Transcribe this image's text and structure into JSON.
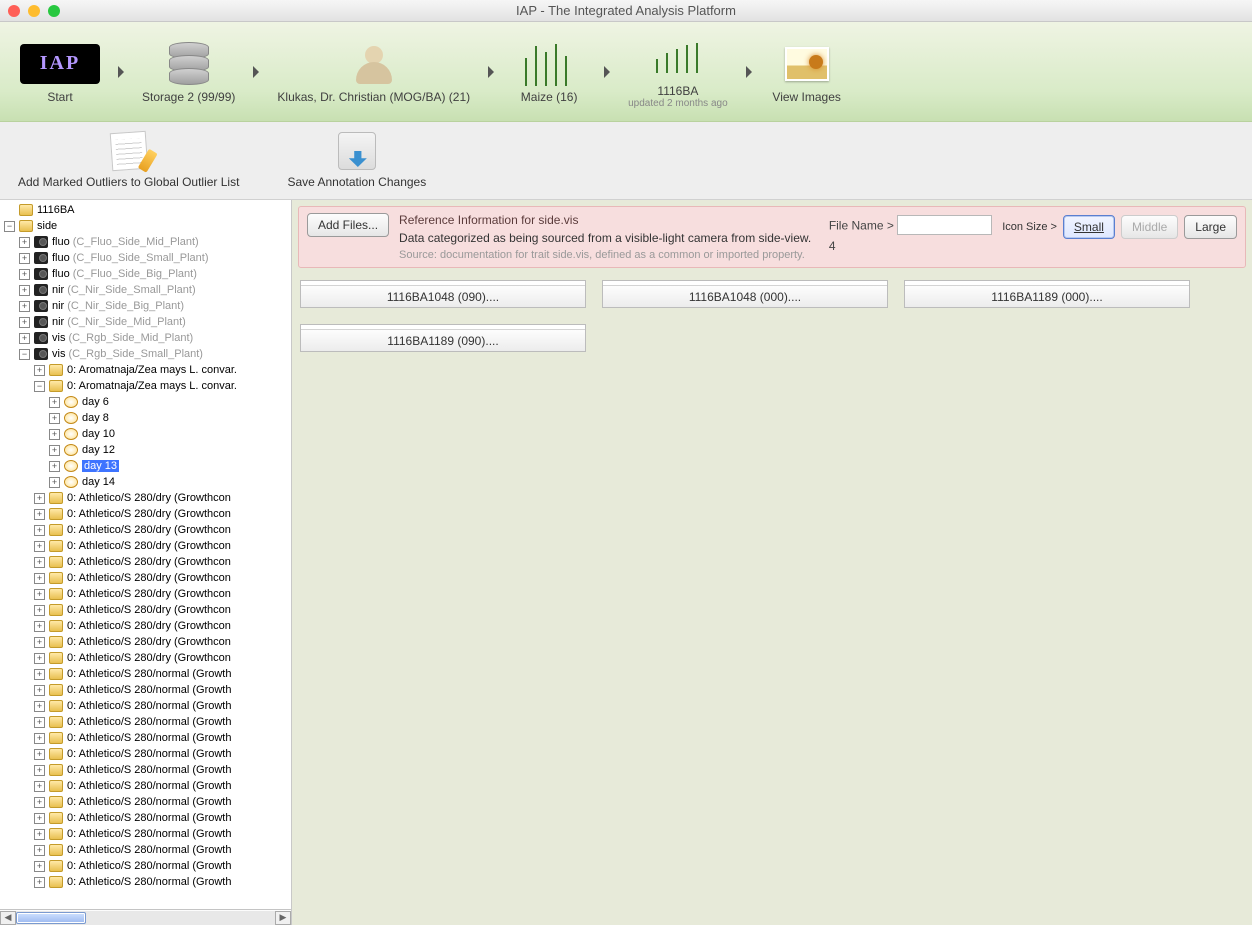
{
  "window": {
    "title": "IAP - The Integrated Analysis Platform"
  },
  "breadcrumb": [
    {
      "label": "Start",
      "icon": "iap"
    },
    {
      "label": "Storage 2 (99/99)",
      "icon": "db"
    },
    {
      "label": "Klukas, Dr. Christian (MOG/BA) (21)",
      "icon": "person"
    },
    {
      "label": "Maize (16)",
      "icon": "plants-big"
    },
    {
      "label": "1116BA",
      "sub": "updated 2 months ago",
      "icon": "plants-small"
    },
    {
      "label": "View Images",
      "icon": "photo"
    }
  ],
  "toolbar": {
    "outliers": "Add Marked Outliers to Global Outlier List",
    "save": "Save Annotation Changes"
  },
  "tree": {
    "root": "1116BA",
    "side": "side",
    "cams": [
      {
        "name": "fluo",
        "hint": "(C_Fluo_Side_Mid_Plant)"
      },
      {
        "name": "fluo",
        "hint": "(C_Fluo_Side_Small_Plant)"
      },
      {
        "name": "fluo",
        "hint": "(C_Fluo_Side_Big_Plant)"
      },
      {
        "name": "nir",
        "hint": "(C_Nir_Side_Small_Plant)"
      },
      {
        "name": "nir",
        "hint": "(C_Nir_Side_Big_Plant)"
      },
      {
        "name": "nir",
        "hint": "(C_Nir_Side_Mid_Plant)"
      },
      {
        "name": "vis",
        "hint": "(C_Rgb_Side_Mid_Plant)"
      },
      {
        "name": "vis",
        "hint": "(C_Rgb_Side_Small_Plant)",
        "expanded": true
      }
    ],
    "aroma1": "0: Aromatnaja/Zea mays L. convar.",
    "aroma2": "0: Aromatnaja/Zea mays L. convar.",
    "days": [
      "day 6",
      "day 8",
      "day 10",
      "day 12",
      "day 13",
      "day 14"
    ],
    "daysSelectedIndex": 4,
    "athletico": [
      "0: Athletico/S 280/dry (Growthcon",
      "0: Athletico/S 280/dry (Growthcon",
      "0: Athletico/S 280/dry (Growthcon",
      "0: Athletico/S 280/dry (Growthcon",
      "0: Athletico/S 280/dry (Growthcon",
      "0: Athletico/S 280/dry (Growthcon",
      "0: Athletico/S 280/dry (Growthcon",
      "0: Athletico/S 280/dry (Growthcon",
      "0: Athletico/S 280/dry (Growthcon",
      "0: Athletico/S 280/dry (Growthcon",
      "0: Athletico/S 280/dry (Growthcon",
      "0: Athletico/S 280/normal (Growth",
      "0: Athletico/S 280/normal (Growth",
      "0: Athletico/S 280/normal (Growth",
      "0: Athletico/S 280/normal (Growth",
      "0: Athletico/S 280/normal (Growth",
      "0: Athletico/S 280/normal (Growth",
      "0: Athletico/S 280/normal (Growth",
      "0: Athletico/S 280/normal (Growth",
      "0: Athletico/S 280/normal (Growth",
      "0: Athletico/S 280/normal (Growth",
      "0: Athletico/S 280/normal (Growth",
      "0: Athletico/S 280/normal (Growth",
      "0: Athletico/S 280/normal (Growth",
      "0: Athletico/S 280/normal (Growth"
    ]
  },
  "info": {
    "addFiles": "Add Files...",
    "refTitle": "Reference Information for side.vis",
    "desc": "Data categorized as being sourced from a visible-light camera from side-view.",
    "source": "Source: documentation for trait side.vis, defined as a common or imported property.",
    "fileNameLabel": "File Name >",
    "fileCount": "4",
    "iconSizeLabel": "Icon Size >",
    "small": "Small",
    "middle": "Middle",
    "large": "Large"
  },
  "thumbs": [
    {
      "caption": "1116BA1048 (090)...."
    },
    {
      "caption": "1116BA1048 (000)...."
    },
    {
      "caption": "1116BA1189 (000)...."
    },
    {
      "caption": "1116BA1189 (090)...."
    }
  ]
}
